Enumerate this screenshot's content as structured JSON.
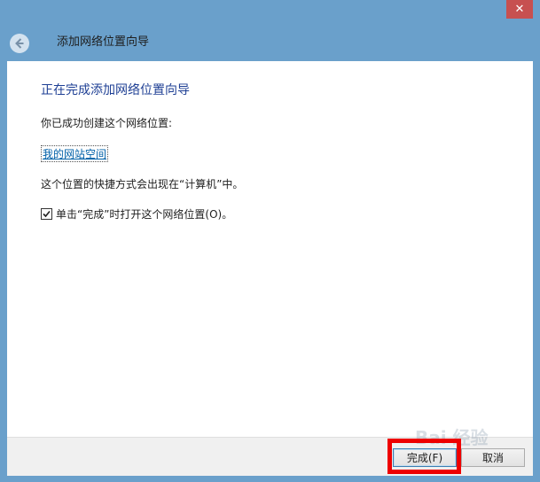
{
  "window": {
    "title": "添加网络位置向导",
    "close_glyph": "✕",
    "back_icon": "back-arrow-icon"
  },
  "content": {
    "heading": "正在完成添加网络位置向导",
    "success_text": "你已成功创建这个网络位置:",
    "location_name": "我的网站空间",
    "shortcut_text": "这个位置的快捷方式会出现在“计算机”中。",
    "open_on_finish": {
      "checked": true,
      "label": "单击“完成”时打开这个网络位置(O)。"
    }
  },
  "footer": {
    "finish_label": "完成(F)",
    "cancel_label": "取消"
  },
  "watermark": "Bai 经验",
  "colors": {
    "frame": "#6aa0cb",
    "heading": "#1e3f94",
    "link": "#0060a8",
    "highlight": "#ee0000"
  }
}
